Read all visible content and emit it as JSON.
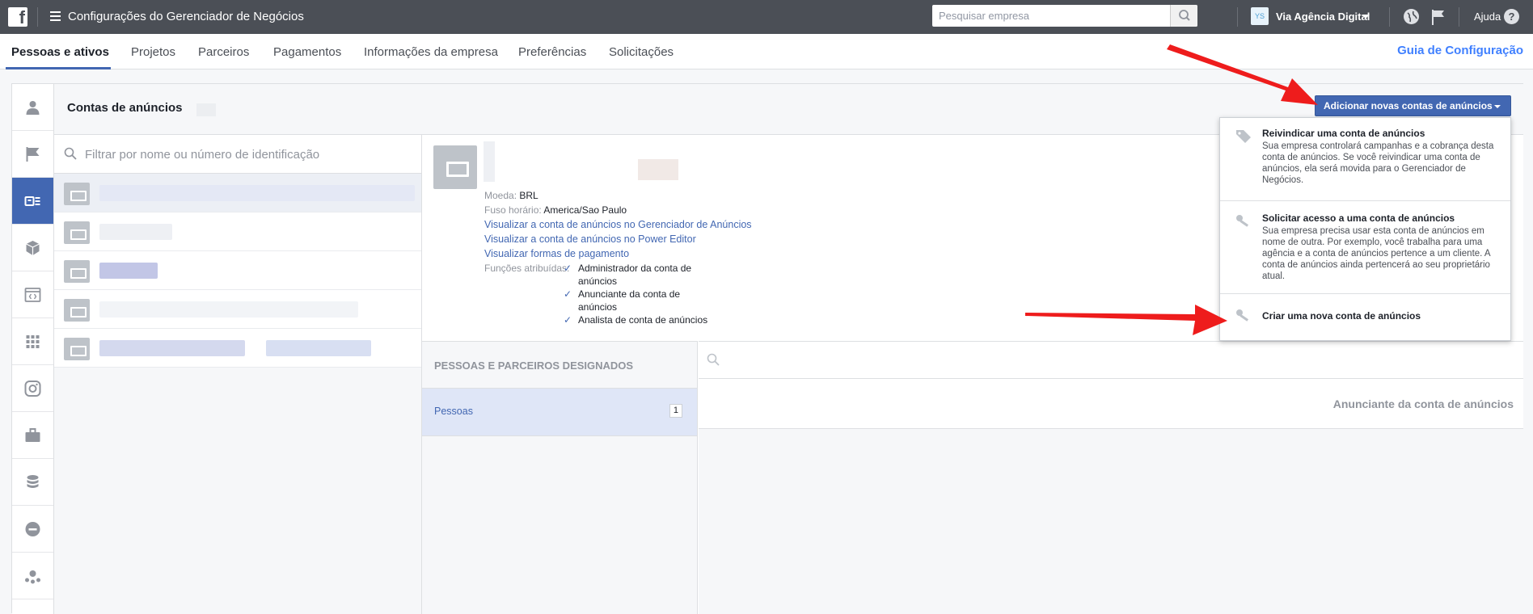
{
  "topbar": {
    "app_title": "Configurações do Gerenciador de Negócios",
    "search_placeholder": "Pesquisar empresa",
    "avatar_initials": "YS",
    "business_name": "Via Agência Digital",
    "help_label": "Ajuda"
  },
  "tabs": [
    "Pessoas e ativos",
    "Projetos",
    "Parceiros",
    "Pagamentos",
    "Informações da empresa",
    "Preferências",
    "Solicitações"
  ],
  "guide_link": "Guia de Configuração",
  "left_rail_icons": [
    "person-icon",
    "flag-icon",
    "ad-account-icon",
    "cube-icon",
    "code-window-icon",
    "apps-grid-icon",
    "instagram-icon",
    "briefcase-icon",
    "database-icon",
    "blocked-icon",
    "network-icon"
  ],
  "list": {
    "title": "Contas de anúncios",
    "filter_placeholder": "Filtrar por nome ou número de identificação"
  },
  "add_button": "Adicionar novas contas de anúncios",
  "dropdown": {
    "claim_title": "Reivindicar uma conta de anúncios",
    "claim_desc": "Sua empresa controlará campanhas e a cobrança desta conta de anúncios. Se você reivindicar uma conta de anúncios, ela será movida para o Gerenciador de Negócios.",
    "request_title": "Solicitar acesso a uma conta de anúncios",
    "request_desc": "Sua empresa precisa usar esta conta de anúncios em nome de outra. Por exemplo, você trabalha para uma agência e a conta de anúncios pertence a um cliente. A conta de anúncios ainda pertencerá ao seu proprietário atual.",
    "create_title": "Criar uma nova conta de anúncios"
  },
  "detail": {
    "currency_key": "Moeda:",
    "currency_val": "BRL",
    "timezone_key": "Fuso horário:",
    "timezone_val": "America/Sao Paulo",
    "link_ads_manager": "Visualizar a conta de anúncios no Gerenciador de Anúncios",
    "link_power_editor": "Visualizar a conta de anúncios no Power Editor",
    "link_payment": "Visualizar formas de pagamento",
    "roles_key": "Funções atribuídas:",
    "role_1a": "Administrador da conta de",
    "role_1b": "anúncios",
    "role_2a": "Anunciante da conta de",
    "role_2b": "anúncios",
    "role_3": "Analista de conta de anúncios"
  },
  "people_section": {
    "header": "PESSOAS E PARCEIROS DESIGNADOS",
    "people_label": "Pessoas",
    "people_count": "1",
    "role_column": "Anunciante da conta de anúncios"
  }
}
